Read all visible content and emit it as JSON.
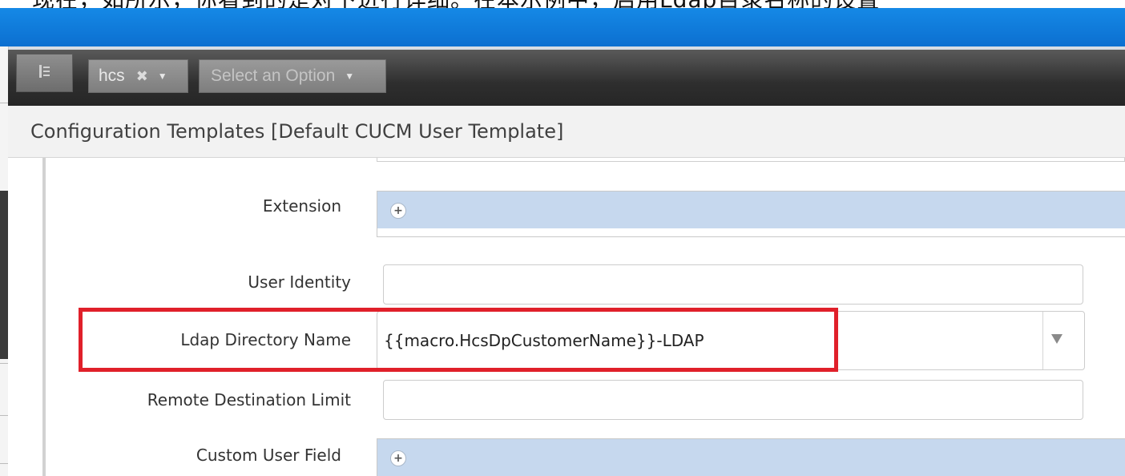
{
  "caption": {
    "text": "现在，如所示，你看到的是对下进行详细。在本示例中，启用Ldap目录名称的设置"
  },
  "toolbar": {
    "menu_icon": "sidebar-toggle-icon",
    "hierarchy_chip": {
      "label": "hcs",
      "remove_glyph": "✖",
      "caret": "▼"
    },
    "option_select": {
      "placeholder": "Select an Option",
      "caret": "▼"
    }
  },
  "page": {
    "title": "Configuration Templates [Default CUCM User Template]"
  },
  "form": {
    "extension": {
      "label": "Extension",
      "add_glyph": "+"
    },
    "user_identity": {
      "label": "User Identity",
      "value": ""
    },
    "ldap_directory_name": {
      "label": "Ldap Directory Name",
      "value": "{{macro.HcsDpCustomerName}}-LDAP"
    },
    "remote_destination_limit": {
      "label": "Remote Destination Limit",
      "value": ""
    },
    "custom_user_field": {
      "label": "Custom User Field",
      "add_glyph": "+"
    }
  },
  "colors": {
    "header_blue": "#0c6fd0",
    "toolbar_dark": "#2e2e2e",
    "list_field_blue": "#c6d8ee",
    "highlight_red": "#e0202a"
  }
}
